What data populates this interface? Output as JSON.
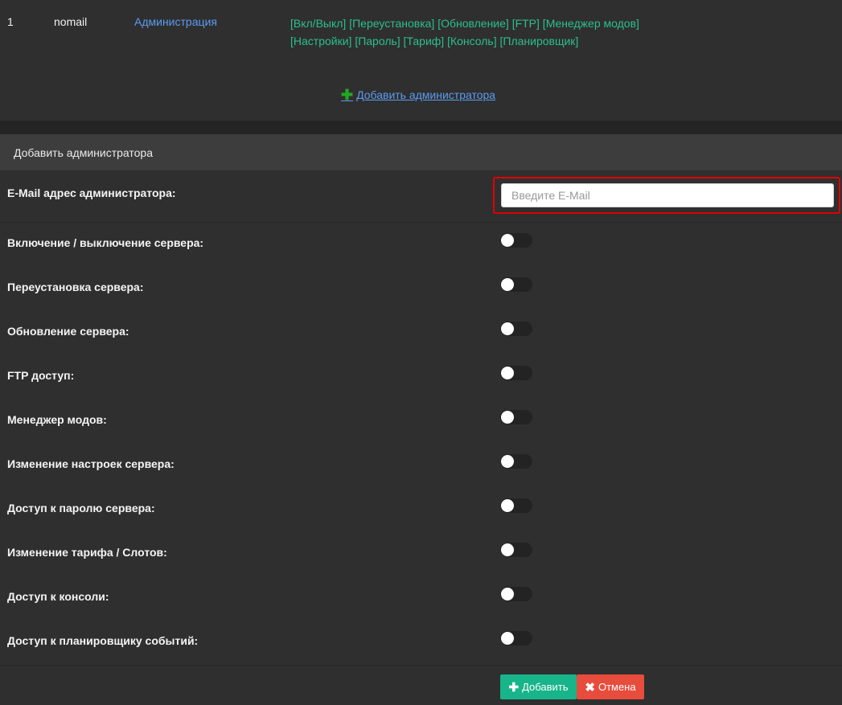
{
  "admin_table": {
    "rows": [
      {
        "id": "1",
        "email": "nomail",
        "role": "Администрация",
        "permissions_line1": "[Вкл/Выкл] [Переустановка] [Обновление] [FTP] [Менеджер модов]",
        "permissions_line2": "[Настройки] [Пароль] [Тариф] [Консоль] [Планировщик]"
      }
    ],
    "add_link": "Добавить администратора"
  },
  "form": {
    "title": "Добавить администратора",
    "email_label": "E-Mail адрес администратора:",
    "email_placeholder": "Введите E-Mail",
    "email_value": "",
    "toggles": [
      {
        "label": "Включение / выключение сервера:",
        "on": false
      },
      {
        "label": "Переустановка сервера:",
        "on": false
      },
      {
        "label": "Обновление сервера:",
        "on": false
      },
      {
        "label": "FTP доступ:",
        "on": false
      },
      {
        "label": "Менеджер модов:",
        "on": false
      },
      {
        "label": "Изменение настроек сервера:",
        "on": false
      },
      {
        "label": "Доступ к паролю сервера:",
        "on": false
      },
      {
        "label": "Изменение тарифа / Слотов:",
        "on": false
      },
      {
        "label": "Доступ к консоли:",
        "on": false
      },
      {
        "label": "Доступ к планировщику событий:",
        "on": false
      }
    ],
    "add_button": "Добавить",
    "cancel_button": "Отмена"
  },
  "colors": {
    "background": "#2f2f2f",
    "link": "#5b9bef",
    "permission_text": "#2bbf8f",
    "add_button": "#18b48a",
    "cancel_button": "#e74c3c",
    "highlight": "#e00000"
  },
  "icons": {
    "add_link_icon": "plus-icon",
    "add_button_icon": "plus-icon",
    "cancel_button_icon": "close-icon"
  }
}
